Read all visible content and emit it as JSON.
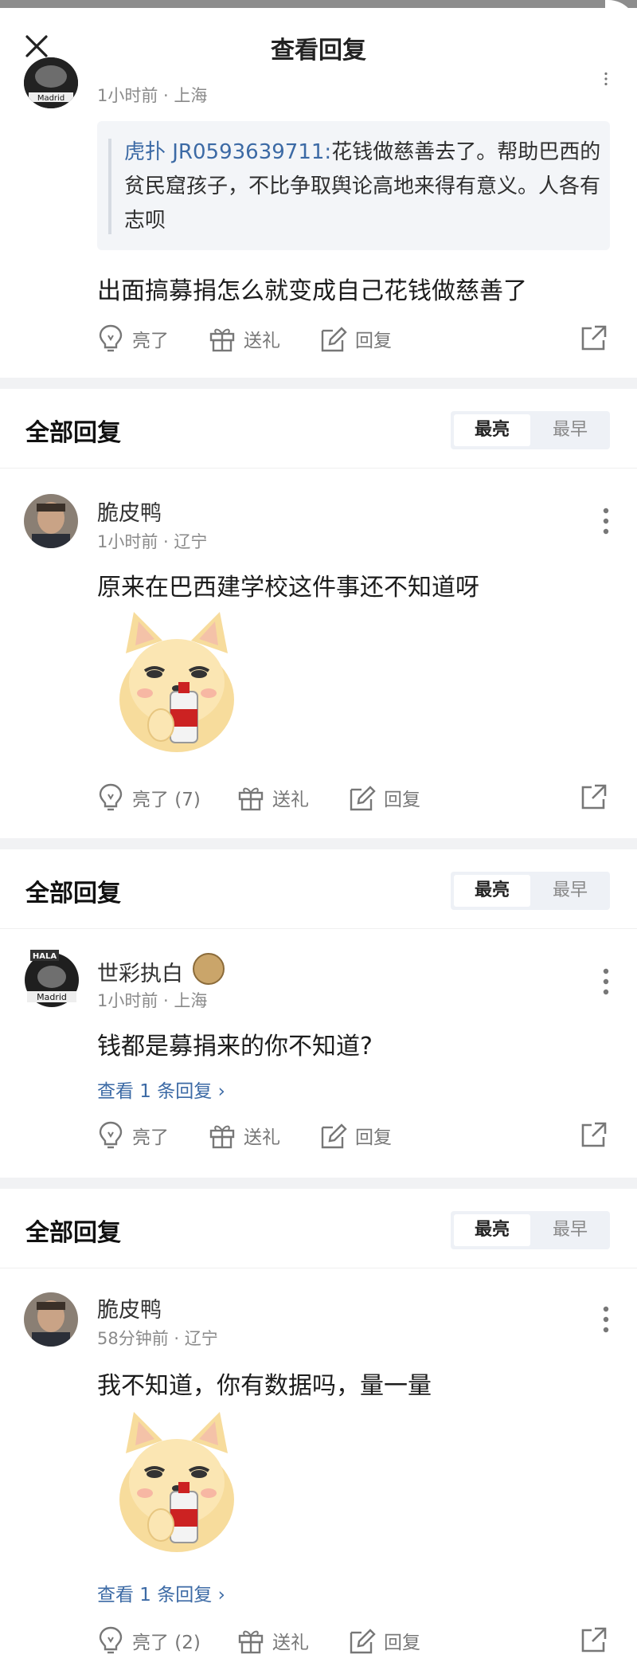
{
  "header": {
    "title": "查看回复"
  },
  "top_comment": {
    "meta": "1小时前 · 上海",
    "quote_name": "虎扑 JR0593639711:",
    "quote_text": "花钱做慈善去了。帮助巴西的贫民窟孩子，不比争取舆论高地来得有意义。人各有志呗",
    "body": "出面搞募捐怎么就变成自己花钱做慈善了",
    "actions": {
      "like": "亮了",
      "gift": "送礼",
      "reply": "回复"
    }
  },
  "sections": [
    {
      "title": "全部回复",
      "sort_hot": "最亮",
      "sort_early": "最早",
      "comment": {
        "username": "脆皮鸭",
        "meta": "1小时前 · 辽宁",
        "body": "原来在巴西建学校这件事还不知道呀",
        "view_replies": "",
        "actions": {
          "like": "亮了 (7)",
          "gift": "送礼",
          "reply": "回复"
        }
      }
    },
    {
      "title": "全部回复",
      "sort_hot": "最亮",
      "sort_early": "最早",
      "comment": {
        "username": "世彩执白",
        "meta": "1小时前 · 上海",
        "body": "钱都是募捐来的你不知道?",
        "view_replies": "查看 1 条回复 ›",
        "actions": {
          "like": "亮了",
          "gift": "送礼",
          "reply": "回复"
        }
      }
    },
    {
      "title": "全部回复",
      "sort_hot": "最亮",
      "sort_early": "最早",
      "comment": {
        "username": "脆皮鸭",
        "meta": "58分钟前 · 辽宁",
        "body": "我不知道，你有数据吗，量一量",
        "view_replies": "查看 1 条回复 ›",
        "actions": {
          "like": "亮了 (2)",
          "gift": "送礼",
          "reply": "回复"
        }
      }
    }
  ],
  "colors": {
    "link": "#3c6aa5",
    "divider": "#f1f2f4",
    "segment_bg": "#eef1f6"
  }
}
